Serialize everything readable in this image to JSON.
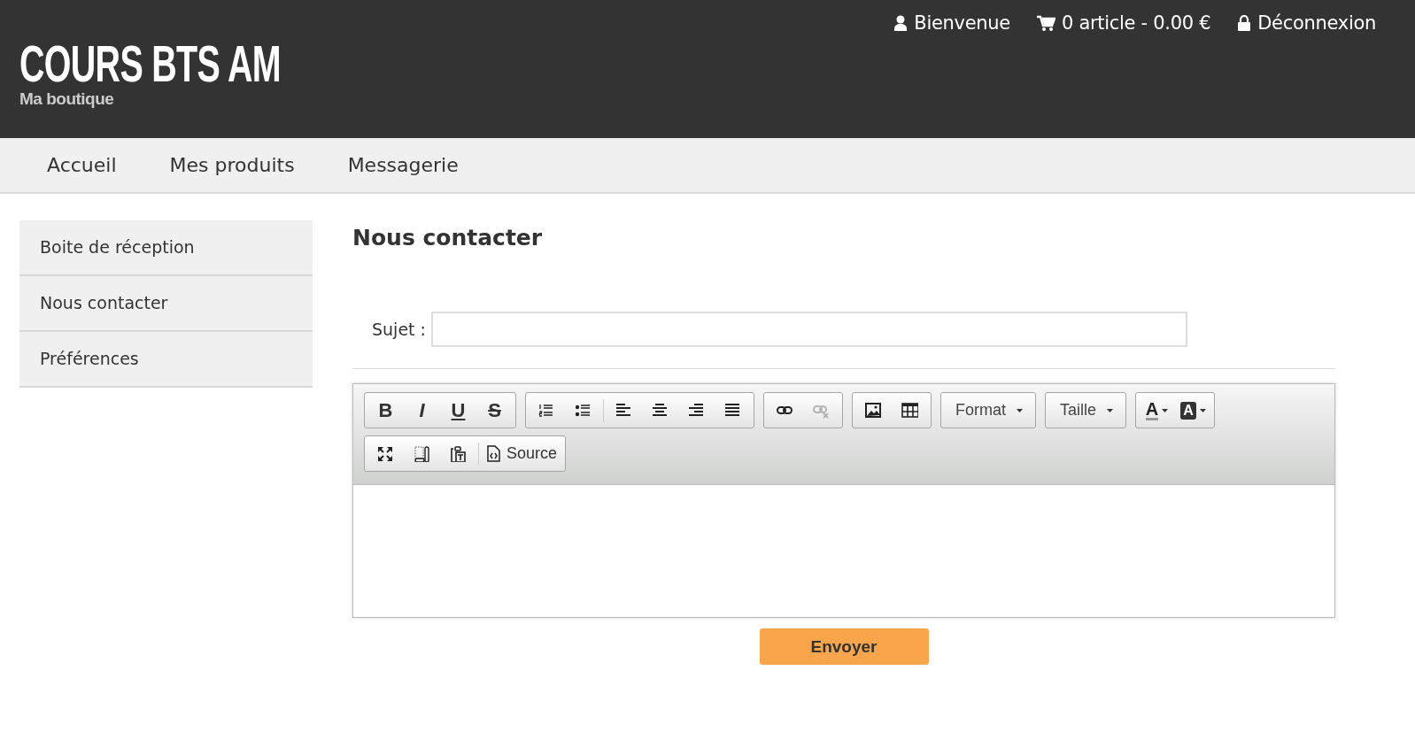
{
  "header": {
    "user_links": [
      {
        "kind": "user",
        "label": "Bienvenue"
      },
      {
        "kind": "cart",
        "label": "0 article - 0.00 €"
      },
      {
        "kind": "lock",
        "label": "Déconnexion"
      }
    ],
    "site_title": "COURS BTS AM",
    "site_subtitle": "Ma boutique"
  },
  "nav": [
    {
      "label": "Accueil"
    },
    {
      "label": "Mes produits"
    },
    {
      "label": "Messagerie"
    }
  ],
  "sidebar": {
    "items": [
      {
        "label": "Boite de réception"
      },
      {
        "label": "Nous contacter"
      },
      {
        "label": "Préférences"
      }
    ]
  },
  "main": {
    "title": "Nous contacter",
    "subject_label": "Sujet :",
    "editor": {
      "toolbar_rows": [
        {
          "groups": [
            {
              "items": [
                {
                  "kind": "glyph",
                  "text": "B",
                  "disabled": false
                },
                {
                  "kind": "glyph",
                  "text": "I",
                  "disabled": false
                },
                {
                  "kind": "glyph",
                  "text": "U",
                  "disabled": false
                },
                {
                  "kind": "glyph",
                  "text": "S",
                  "disabled": false
                }
              ]
            },
            {
              "items": [
                {
                  "kind": "icon",
                  "disabled": false
                },
                {
                  "kind": "icon",
                  "disabled": false
                },
                {
                  "kind": "separator"
                },
                {
                  "kind": "icon",
                  "disabled": false
                },
                {
                  "kind": "icon",
                  "disabled": false
                },
                {
                  "kind": "icon",
                  "disabled": false
                },
                {
                  "kind": "icon",
                  "disabled": false
                }
              ]
            },
            {
              "items": [
                {
                  "kind": "icon",
                  "disabled": false
                },
                {
                  "kind": "icon",
                  "disabled": true
                }
              ]
            },
            {
              "items": [
                {
                  "kind": "icon",
                  "disabled": false
                },
                {
                  "kind": "icon",
                  "disabled": false
                }
              ]
            },
            {
              "items": [
                {
                  "kind": "combo",
                  "label": "Format"
                }
              ]
            },
            {
              "items": [
                {
                  "kind": "combo",
                  "label": "Taille"
                }
              ]
            },
            {
              "items": [
                {
                  "kind": "text_color",
                  "text": "A",
                  "disabled": false
                },
                {
                  "kind": "bg_color",
                  "text": "A",
                  "disabled": false
                }
              ]
            }
          ]
        },
        {
          "groups": [
            {
              "items": [
                {
                  "kind": "icon",
                  "disabled": false
                },
                {
                  "kind": "icon",
                  "disabled": false
                },
                {
                  "kind": "icon",
                  "disabled": false
                },
                {
                  "kind": "separator"
                },
                {
                  "kind": "text_button",
                  "label": "Source",
                  "disabled": false
                }
              ]
            }
          ]
        }
      ]
    },
    "submit_label": "Envoyer"
  }
}
